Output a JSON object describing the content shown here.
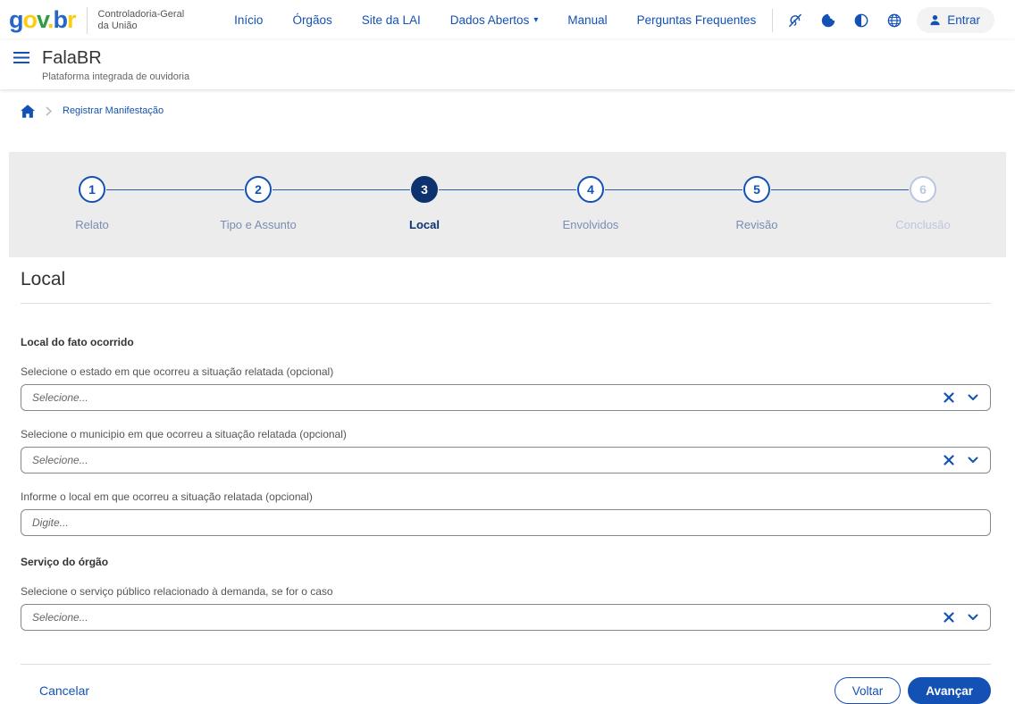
{
  "colors": {
    "accent_blue": "#1351B4",
    "active_step_navy": "#0C326F",
    "stepper_band_bg": "#ECECEC",
    "logo_blue": "#2566C8",
    "logo_yellow": "#FFCD07",
    "logo_green": "#2F9E41"
  },
  "topbar": {
    "logo_letters": [
      {
        "ch": "g"
      },
      {
        "ch": "o"
      },
      {
        "ch": "v"
      },
      {
        "ch": "."
      },
      {
        "ch": "b"
      },
      {
        "ch": "r"
      }
    ],
    "org_line1": "Controladoria-Geral",
    "org_line2": "da União",
    "nav": [
      {
        "label": "Início"
      },
      {
        "label": "Órgãos"
      },
      {
        "label": "Site da LAI"
      },
      {
        "label": "Dados Abertos",
        "has_dropdown": true
      },
      {
        "label": "Manual"
      },
      {
        "label": "Perguntas Frequentes"
      }
    ],
    "icons": [
      "accessibility",
      "cookie",
      "contrast",
      "language"
    ],
    "login_label": "Entrar"
  },
  "app_header": {
    "title": "FalaBR",
    "subtitle": "Plataforma integrada de ouvidoria"
  },
  "breadcrumb": {
    "current": "Registrar Manifestação"
  },
  "stepper": {
    "steps": [
      {
        "number": "1",
        "label": "Relato",
        "state": "done"
      },
      {
        "number": "2",
        "label": "Tipo e Assunto",
        "state": "done"
      },
      {
        "number": "3",
        "label": "Local",
        "state": "active"
      },
      {
        "number": "4",
        "label": "Envolvidos",
        "state": "upcoming"
      },
      {
        "number": "5",
        "label": "Revisão",
        "state": "upcoming"
      },
      {
        "number": "6",
        "label": "Conclusão",
        "state": "disabled"
      }
    ]
  },
  "main": {
    "section_title": "Local",
    "groups": [
      {
        "title": "Local do fato ocorrido"
      },
      {
        "title": "Serviço do órgão"
      }
    ],
    "fields": [
      {
        "label": "Selecione o estado em que ocorreu a situação relatada (opcional)",
        "placeholder": "Selecione...",
        "type": "select"
      },
      {
        "label": "Selecione o municipio em que ocorreu a situação relatada (opcional)",
        "placeholder": "Selecione...",
        "type": "select"
      },
      {
        "label": "Informe o local em que ocorreu a situação relatada (opcional)",
        "placeholder": "Digite...",
        "type": "text"
      },
      {
        "label": "Selecione o serviço público relacionado à demanda, se for o caso",
        "placeholder": "Selecione...",
        "type": "select"
      }
    ]
  },
  "footer": {
    "cancel_label": "Cancelar",
    "back_label": "Voltar",
    "next_label": "Avançar"
  }
}
